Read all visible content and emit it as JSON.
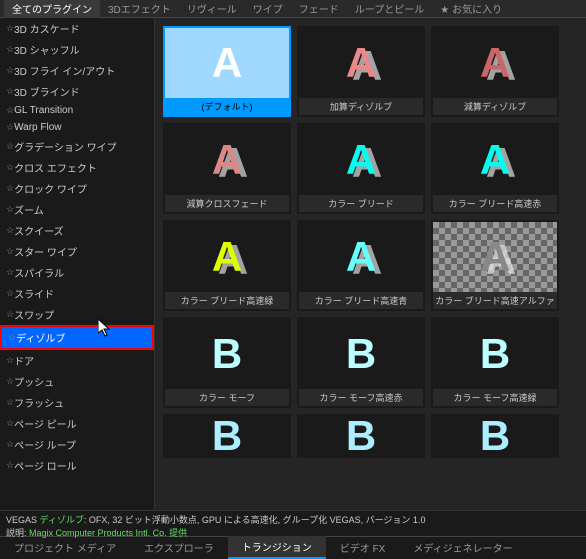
{
  "topTabs": [
    {
      "label": "全てのプラグイン",
      "active": true
    },
    {
      "label": "3Dエフェクト",
      "active": false
    },
    {
      "label": "リヴィール",
      "active": false
    },
    {
      "label": "ワイプ",
      "active": false
    },
    {
      "label": "フェード",
      "active": false
    },
    {
      "label": "ループとピール",
      "active": false
    },
    {
      "label": "お気に入り",
      "active": false,
      "fav": true
    }
  ],
  "sidebar": [
    "3D カスケード",
    "3D シャッフル",
    "3D フライ イン/アウト",
    "3D ブラインド",
    "GL Transition",
    "Warp Flow",
    "グラデーション ワイプ",
    "クロス エフェクト",
    "クロック ワイプ",
    "ズーム",
    "スクイーズ",
    "スター ワイプ",
    "スパイラル",
    "スライド",
    "スワップ",
    "ディゾルブ",
    "ドア",
    "プッシュ",
    "フラッシュ",
    "ページ ピール",
    "ページ ループ",
    "ページ ロール"
  ],
  "selectedSidebarIndex": 15,
  "tiles": [
    {
      "label": "(デフォルト)",
      "bg": "#a0d8ff",
      "fg": "#ffffff",
      "text": "A",
      "selected": true
    },
    {
      "label": "加算ディゾルブ",
      "bg": "#1a1a1a",
      "fg": "#e88",
      "text": "A",
      "overlay": true
    },
    {
      "label": "減算ディゾルブ",
      "bg": "#1a1a1a",
      "fg": "#c66",
      "text": "A",
      "overlay": true
    },
    {
      "label": "減算クロスフェード",
      "bg": "#1a1a1a",
      "fg": "#d88",
      "text": "A",
      "overlay": true
    },
    {
      "label": "カラー ブリード",
      "bg": "#1a1a1a",
      "fg": "#00ffee",
      "text": "A",
      "overlay": true
    },
    {
      "label": "カラー ブリード高速赤",
      "bg": "#1a1a1a",
      "fg": "#00ffee",
      "text": "A",
      "overlay": true
    },
    {
      "label": "カラー ブリード高速緑",
      "bg": "#1a1a1a",
      "fg": "#ddff00",
      "text": "A",
      "overlay": true
    },
    {
      "label": "カラー ブリード高速青",
      "bg": "#1a1a1a",
      "fg": "#66ffff",
      "text": "A",
      "overlay": true
    },
    {
      "label": "カラー ブリード高速アルファ",
      "bg": "checker",
      "fg": "#888",
      "text": "A",
      "overlay": true
    },
    {
      "label": "カラー モーフ",
      "bg": "#1a1a1a",
      "fg": "#bff",
      "text": "B"
    },
    {
      "label": "カラー モーフ高速赤",
      "bg": "#1a1a1a",
      "fg": "#bff",
      "text": "B"
    },
    {
      "label": "カラー モーフ高速緑",
      "bg": "#1a1a1a",
      "fg": "#bff",
      "text": "B"
    },
    {
      "label": "",
      "bg": "#1a1a1a",
      "fg": "#aef",
      "text": "B",
      "partial": true
    },
    {
      "label": "",
      "bg": "#1a1a1a",
      "fg": "#aef",
      "text": "B",
      "partial": true
    },
    {
      "label": "",
      "bg": "#1a1a1a",
      "fg": "#aef",
      "text": "B",
      "partial": true
    }
  ],
  "status": {
    "line1a": "VEGAS ",
    "line1b": "ディゾルブ",
    "line1c": ": OFX, 32 ビット浮動小数点, GPU による高速化, グループ化 VEGAS, バージョン 1.0",
    "line2a": "説明: ",
    "line2b": "Magix Computer Products Intl. Co. 提供"
  },
  "bottomTabs": [
    {
      "label": "プロジェクト メディア",
      "active": false
    },
    {
      "label": "エクスプローラ",
      "active": false
    },
    {
      "label": "トランジション",
      "active": true
    },
    {
      "label": "ビデオ FX",
      "active": false
    },
    {
      "label": "メディジェネレーター",
      "active": false
    }
  ]
}
